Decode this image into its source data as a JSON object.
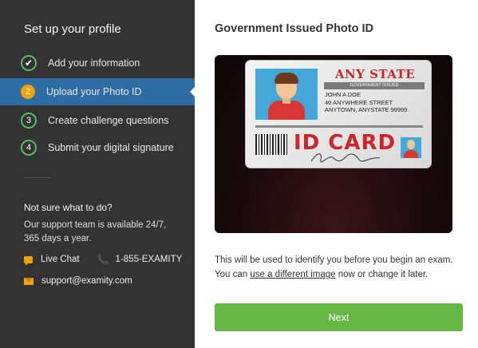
{
  "sidebar": {
    "title": "Set up your profile",
    "steps": [
      {
        "number": "✔",
        "label": "Add your information",
        "state": "done"
      },
      {
        "number": "2",
        "label": "Upload your Photo ID",
        "state": "current"
      },
      {
        "number": "3",
        "label": "Create challenge questions",
        "state": "pending"
      },
      {
        "number": "4",
        "label": "Submit your digital signature",
        "state": "pending"
      }
    ],
    "help_title": "Not sure what to do?",
    "help_text": "Our support team is available 24/7, 365 days a year.",
    "live_chat": "Live Chat",
    "phone": "1-855-EXAMITY",
    "email": "support@examity.com"
  },
  "main": {
    "title": "Government Issued Photo ID",
    "idcard": {
      "state": "ANY STATE",
      "gov_label": "GOVERNMENT ISSUED",
      "line1": "JOHN A DOE",
      "line2": "40 ANYWHERE STREET",
      "line3": "ANYTOWN, ANYSTATE 99999",
      "big_text": "ID CARD"
    },
    "info_before": "This will be used to identify you before you begin an exam. You can ",
    "info_link": "use a different image",
    "info_after": " now or change it later.",
    "next_label": "Next"
  },
  "colors": {
    "sidebar_bg": "#333333",
    "active_step": "#2e6da4",
    "accent_orange": "#f0a30a",
    "step_green": "#5cb85c",
    "next_green": "#66b845"
  }
}
